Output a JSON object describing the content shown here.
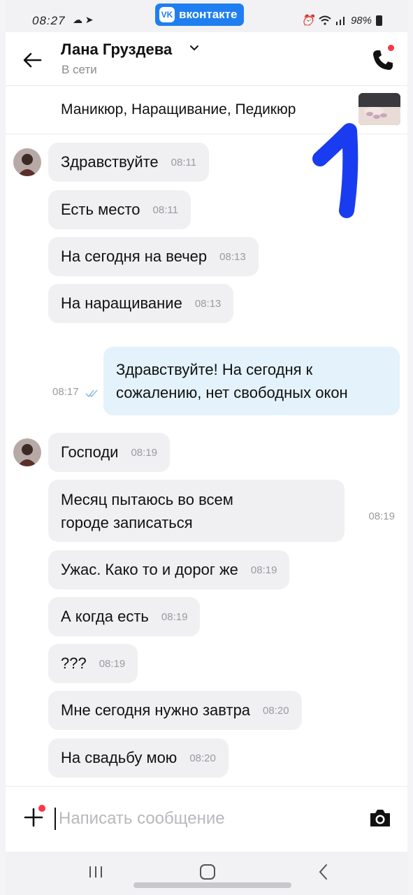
{
  "status_bar": {
    "time": "08:27",
    "left_icons": "☁ ➤",
    "app_badge": "вконтакте",
    "battery": "98%"
  },
  "header": {
    "contact_name": "Лана Груздева",
    "contact_status": "В сети"
  },
  "pinned": {
    "title": "Маникюр, Наращивание, Педикюр"
  },
  "messages": [
    {
      "dir": "in",
      "text": "Здравствуйте",
      "time": "08:11"
    },
    {
      "dir": "in",
      "text": "Есть место",
      "time": "08:11"
    },
    {
      "dir": "in",
      "text": "На сегодня на вечер",
      "time": "08:13"
    },
    {
      "dir": "in",
      "text": "На наращивание",
      "time": "08:13"
    },
    {
      "dir": "out",
      "text": "Здравствуйте! На сегодня к сожалению, нет свободных окон",
      "time": "08:17",
      "read": true
    },
    {
      "dir": "in",
      "text": "Господи",
      "time": "08:19"
    },
    {
      "dir": "in",
      "text": "Месяц пытаюсь во всем городе записаться",
      "time": "08:19"
    },
    {
      "dir": "in",
      "text": "Ужас. Како то и дорог же",
      "time": "08:19"
    },
    {
      "dir": "in",
      "text": "А когда есть",
      "time": "08:19"
    },
    {
      "dir": "in",
      "text": "???",
      "time": "08:19"
    },
    {
      "dir": "in",
      "text": "Мне сегодня нужно завтра",
      "time": "08:20"
    },
    {
      "dir": "in",
      "text": "На свадьбу мою",
      "time": "08:20"
    }
  ],
  "composer": {
    "placeholder": "Написать сообщение"
  },
  "colors": {
    "vk_blue": "#1f7ff0",
    "incoming_bubble": "#f0f0f2",
    "outgoing_bubble": "#e3f2fb",
    "notification_dot": "#ff3347",
    "annotation_marker": "#1a3cf0"
  }
}
